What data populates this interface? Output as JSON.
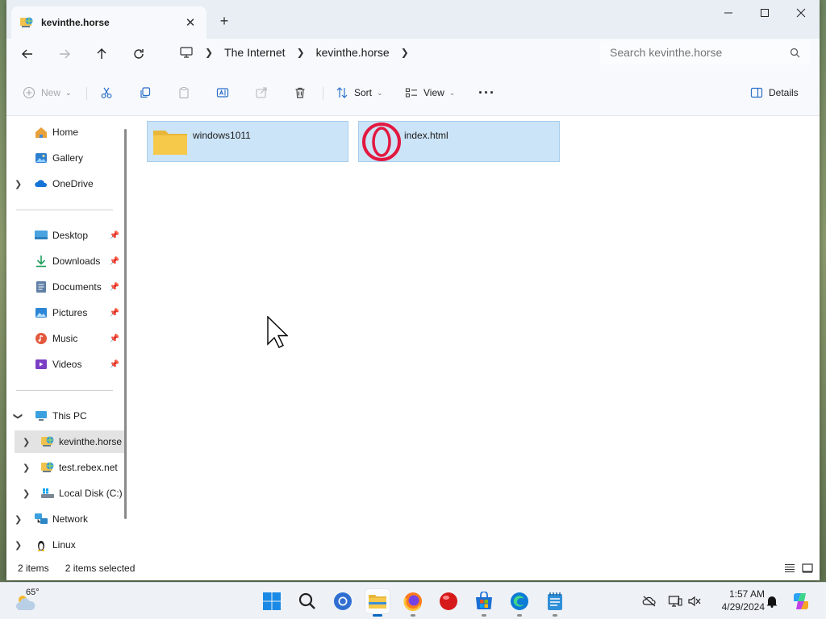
{
  "tab": {
    "title": "kevinthe.horse",
    "close_glyph": "✕",
    "new_glyph": "+"
  },
  "window_controls": {
    "minimize": "—",
    "maximize": "☐",
    "close": "✕"
  },
  "nav": {
    "breadcrumbs": [
      "The Internet",
      "kevinthe.horse"
    ],
    "search_placeholder": "Search kevinthe.horse"
  },
  "toolbar": {
    "new_label": "New",
    "sort_label": "Sort",
    "view_label": "View",
    "more_label": "···",
    "details_label": "Details"
  },
  "sidebar": {
    "quick": [
      {
        "label": "Home",
        "icon": "home-icon"
      },
      {
        "label": "Gallery",
        "icon": "gallery-icon"
      },
      {
        "label": "OneDrive",
        "icon": "cloud-icon"
      }
    ],
    "pinned": [
      {
        "label": "Desktop",
        "icon": "desktop-icon"
      },
      {
        "label": "Downloads",
        "icon": "download-icon"
      },
      {
        "label": "Documents",
        "icon": "documents-icon"
      },
      {
        "label": "Pictures",
        "icon": "pictures-icon"
      },
      {
        "label": "Music",
        "icon": "music-icon"
      },
      {
        "label": "Videos",
        "icon": "videos-icon"
      }
    ],
    "this_pc": "This PC",
    "drives": [
      {
        "label": "kevinthe.horse",
        "icon": "network-drive-icon"
      },
      {
        "label": "test.rebex.net",
        "icon": "network-drive-icon"
      },
      {
        "label": "Local Disk (C:)",
        "icon": "disk-icon"
      }
    ],
    "network": "Network",
    "linux": "Linux"
  },
  "files": [
    {
      "name": "windows1011",
      "type": "folder",
      "icon": "folder-icon"
    },
    {
      "name": "index.html",
      "type": "html",
      "icon": "opera-icon"
    }
  ],
  "status": {
    "count": "2 items",
    "selected": "2 items selected"
  },
  "taskbar": {
    "temperature": "65°",
    "time": "1:57 AM",
    "date": "4/29/2024"
  },
  "colors": {
    "accent": "#0067c0",
    "selection": "#cce4f7",
    "folder": "#f7c94b",
    "opera": "#e21840"
  }
}
